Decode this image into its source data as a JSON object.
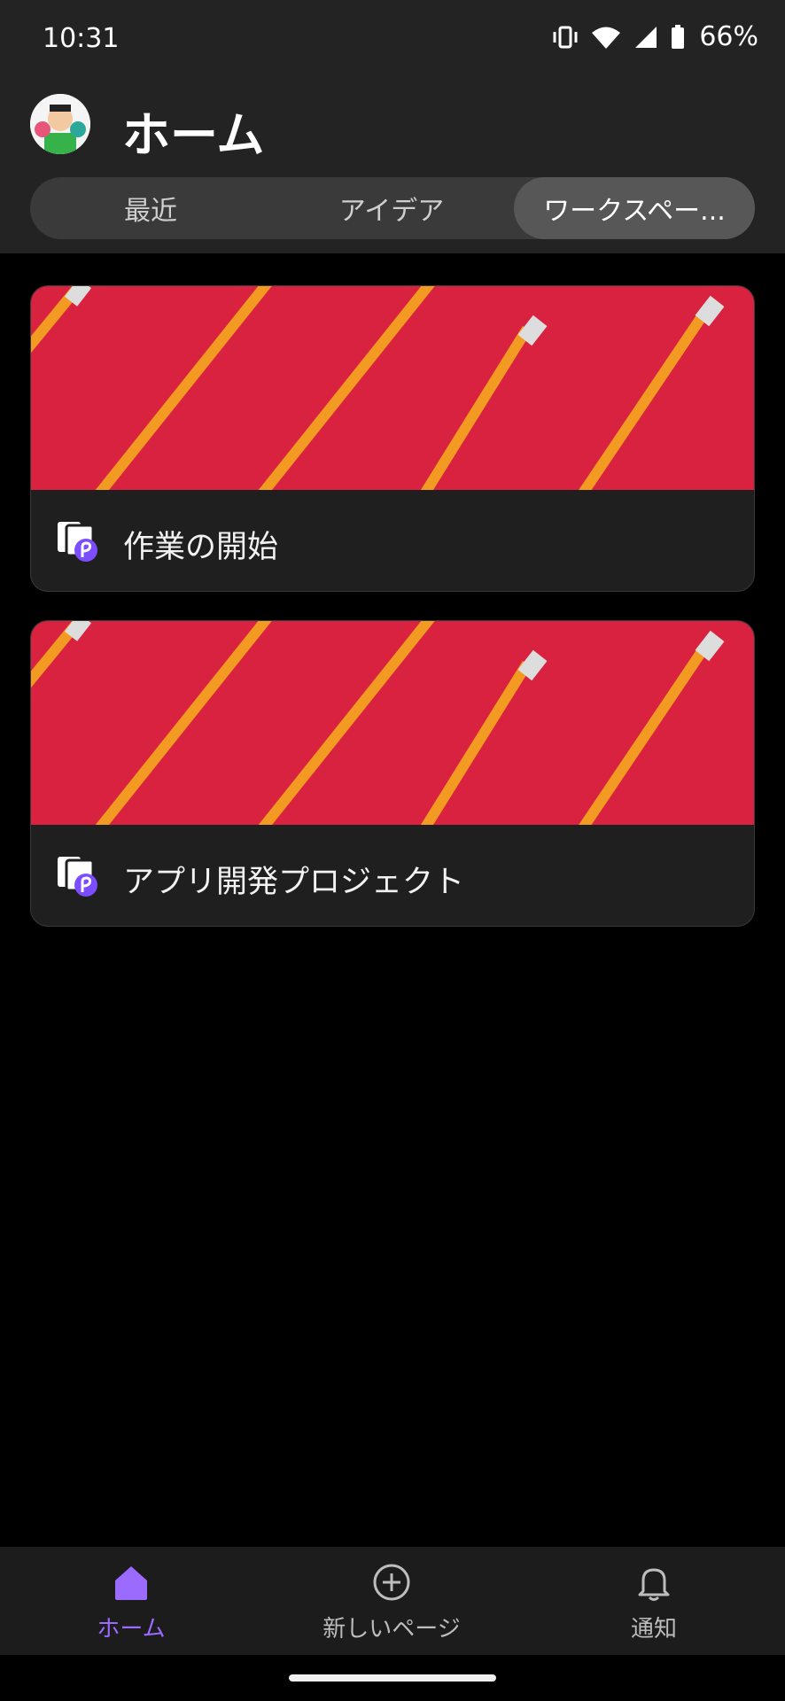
{
  "status_bar": {
    "time": "10:31",
    "battery": "66%",
    "icons": [
      "vibrate-icon",
      "wifi-icon",
      "signal-icon",
      "battery-icon"
    ]
  },
  "header": {
    "title": "ホーム",
    "avatar": "avatar"
  },
  "tabs": [
    {
      "label": "最近",
      "active": false
    },
    {
      "label": "アイデア",
      "active": false
    },
    {
      "label": "ワークスペー...",
      "active": true
    }
  ],
  "cards": [
    {
      "title": "作業の開始",
      "cover": "red pencils",
      "icon": "page-icon"
    },
    {
      "title": "アプリ開発プロジェクト",
      "cover": "red pencils",
      "icon": "page-icon"
    }
  ],
  "bottom_nav": [
    {
      "label": "ホーム",
      "icon": "home-icon",
      "active": true
    },
    {
      "label": "新しいページ",
      "icon": "add-circle-icon",
      "active": false
    },
    {
      "label": "通知",
      "icon": "bell-icon",
      "active": false
    }
  ],
  "colors": {
    "accent": "#9b6bff",
    "cover_red": "#d8223f",
    "pencil": "#f29a22"
  }
}
